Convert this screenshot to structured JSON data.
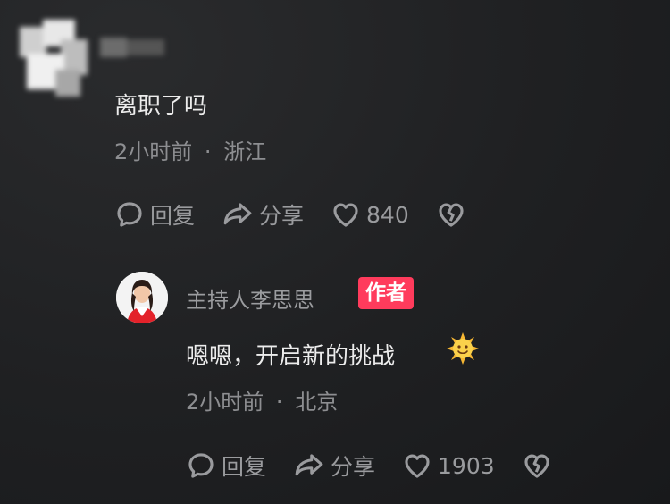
{
  "comment": {
    "text": "离职了吗",
    "time": "2小时前",
    "location": "浙江",
    "reply_label": "回复",
    "share_label": "分享",
    "likes": "840"
  },
  "reply": {
    "author": "主持人李思思",
    "badge": "作者",
    "text": "嗯嗯，开启新的挑战",
    "emoji_icon": "sun-emoji",
    "time": "2小时前",
    "location": "北京",
    "reply_label": "回复",
    "share_label": "分享",
    "likes": "1903"
  },
  "separator": "·",
  "colors": {
    "background": "#1c1d1f",
    "badge": "#ff3b5c",
    "text_primary": "#ececec",
    "text_secondary": "#8d8e91"
  }
}
